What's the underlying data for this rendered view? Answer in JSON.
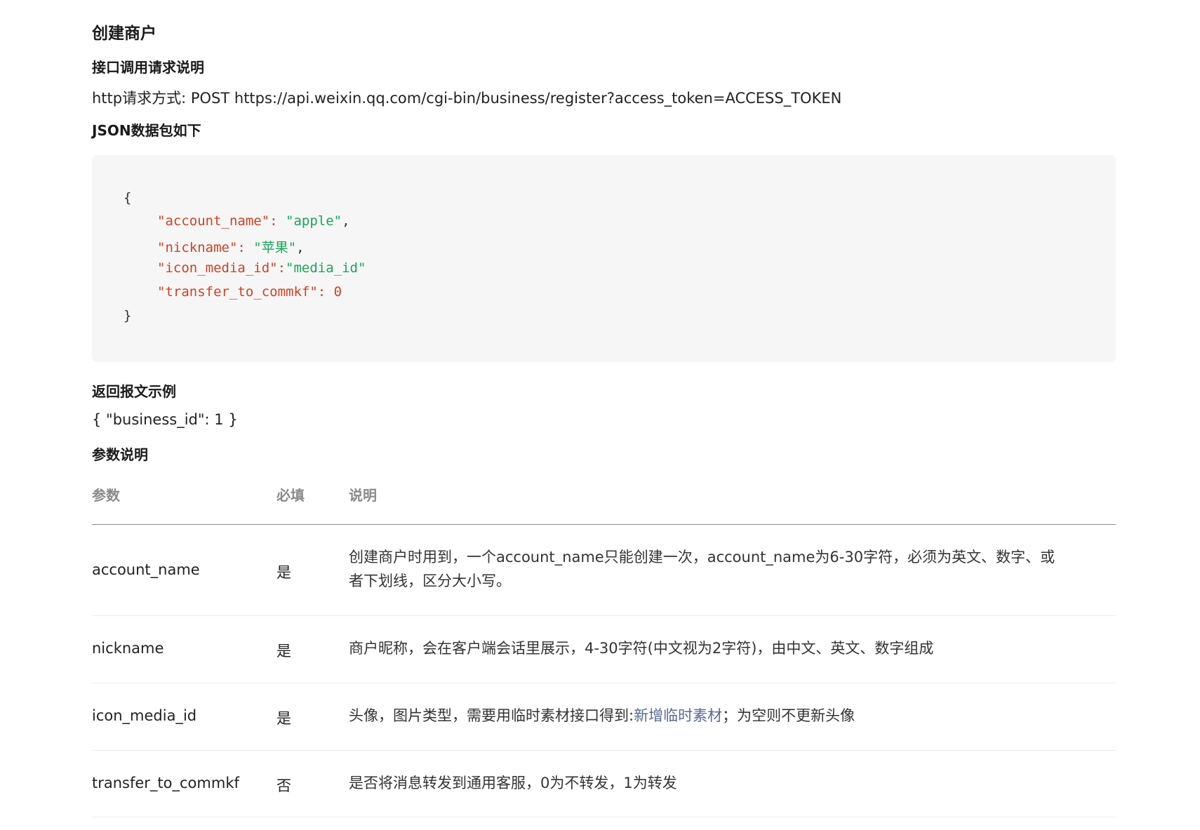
{
  "title": "创建商户",
  "request_heading": "接口调用请求说明",
  "request_line": "http请求方式: POST https://api.weixin.qq.com/cgi-bin/business/register?access_token=ACCESS_TOKEN",
  "json_heading": "JSON数据包如下",
  "code": {
    "open": "{",
    "close": "}",
    "lines": [
      {
        "key": "\"account_name\"",
        "sep": ": ",
        "value": "\"apple\"",
        "tail": ","
      },
      {
        "key": "\"nickname\"",
        "sep": ": ",
        "value": "\"苹果\"",
        "tail": ","
      },
      {
        "key": "\"icon_media_id\"",
        "sep": ":",
        "value": "\"media_id\"",
        "tail": ""
      },
      {
        "key": "\"transfer_to_commkf\"",
        "sep": ": ",
        "value": "0",
        "tail": ""
      }
    ]
  },
  "response_heading": "返回报文示例",
  "response_example": "{ \"business_id\": 1 }",
  "params_heading": "参数说明",
  "table": {
    "headers": [
      "参数",
      "必填",
      "说明"
    ],
    "rows": [
      {
        "param": "account_name",
        "required": "是",
        "desc": "创建商户时用到，一个account_name只能创建一次，account_name为6-30字符，必须为英文、数字、或者下划线，区分大小写。"
      },
      {
        "param": "nickname",
        "required": "是",
        "desc": "商户昵称，会在客户端会话里展示，4-30字符(中文视为2字符)，由中文、英文、数字组成"
      },
      {
        "param": "icon_media_id",
        "required": "是",
        "desc_before": "头像，图片类型，需要用临时素材接口得到:",
        "desc_link": "新增临时素材",
        "desc_after": "；为空则不更新头像"
      },
      {
        "param": "transfer_to_commkf",
        "required": "否",
        "desc": "是否将消息转发到通用客服，0为不转发，1为转发"
      }
    ]
  },
  "colors": {
    "link": "#576b95",
    "json_key": "#d14124",
    "json_string": "#1aa55a",
    "code_background": "#f6f6f6"
  }
}
